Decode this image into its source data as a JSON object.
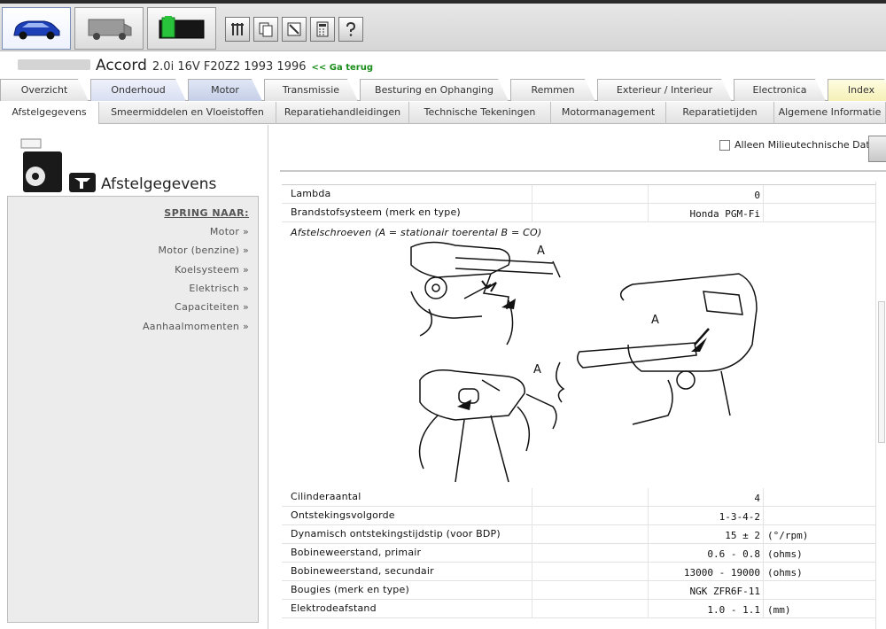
{
  "toolbar": {
    "big_tabs": [
      "car-icon",
      "van-icon",
      "battery-icon"
    ],
    "tools": [
      "tools-icon",
      "copy-icon",
      "edit-icon",
      "calculator-icon",
      "help-icon"
    ]
  },
  "vehicle": {
    "model": "Accord",
    "spec": "2.0i 16V F20Z2 1993 1996",
    "back_link": "<< Ga terug"
  },
  "main_tabs": [
    "Overzicht",
    "Onderhoud",
    "Motor",
    "Transmissie",
    "Besturing en Ophanging",
    "Remmen",
    "Exterieur / Interieur",
    "Electronica",
    "Index"
  ],
  "sub_tabs": [
    "Afstelgegevens",
    "Smeermiddelen en Vloeistoffen",
    "Reparatiehandleidingen",
    "Technische Tekeningen",
    "Motormanagement",
    "Reparatietijden",
    "Algemene Informatie"
  ],
  "left": {
    "title": "Afstelgegevens",
    "nav_heading": "SPRING NAAR:",
    "nav_items": [
      "Motor »",
      "Motor (benzine) »",
      "Koelsysteem »",
      "Elektrisch »",
      "Capaciteiten »",
      "Aanhaalmomenten »"
    ]
  },
  "filter": {
    "label": "Alleen Milieutechnische Data"
  },
  "rows_top": [
    {
      "label": "Lambda",
      "value": "0",
      "unit": ""
    },
    {
      "label": "Brandstofsysteem (merk en type)",
      "value": "Honda PGM-Fi",
      "unit": ""
    }
  ],
  "image_caption": "Afstelschroeven (A = stationair toerental B = CO)",
  "diagram_labels": [
    "A",
    "A",
    "A"
  ],
  "rows_bottom": [
    {
      "label": "Cilinderaantal",
      "value": "4",
      "unit": ""
    },
    {
      "label": "Ontstekingsvolgorde",
      "value": "1-3-4-2",
      "unit": ""
    },
    {
      "label": "Dynamisch ontstekingstijdstip (voor BDP)",
      "value": "15 ± 2",
      "unit": "(°/rpm)"
    },
    {
      "label": "Bobineweerstand, primair",
      "value": "0.6 - 0.8",
      "unit": "(ohms)"
    },
    {
      "label": "Bobineweerstand, secundair",
      "value": "13000 - 19000",
      "unit": "(ohms)"
    },
    {
      "label": "Bougies (merk en type)",
      "value": "NGK ZFR6F-11",
      "unit": ""
    },
    {
      "label": "Elektrodeafstand",
      "value": "1.0 - 1.1",
      "unit": "(mm)"
    }
  ]
}
